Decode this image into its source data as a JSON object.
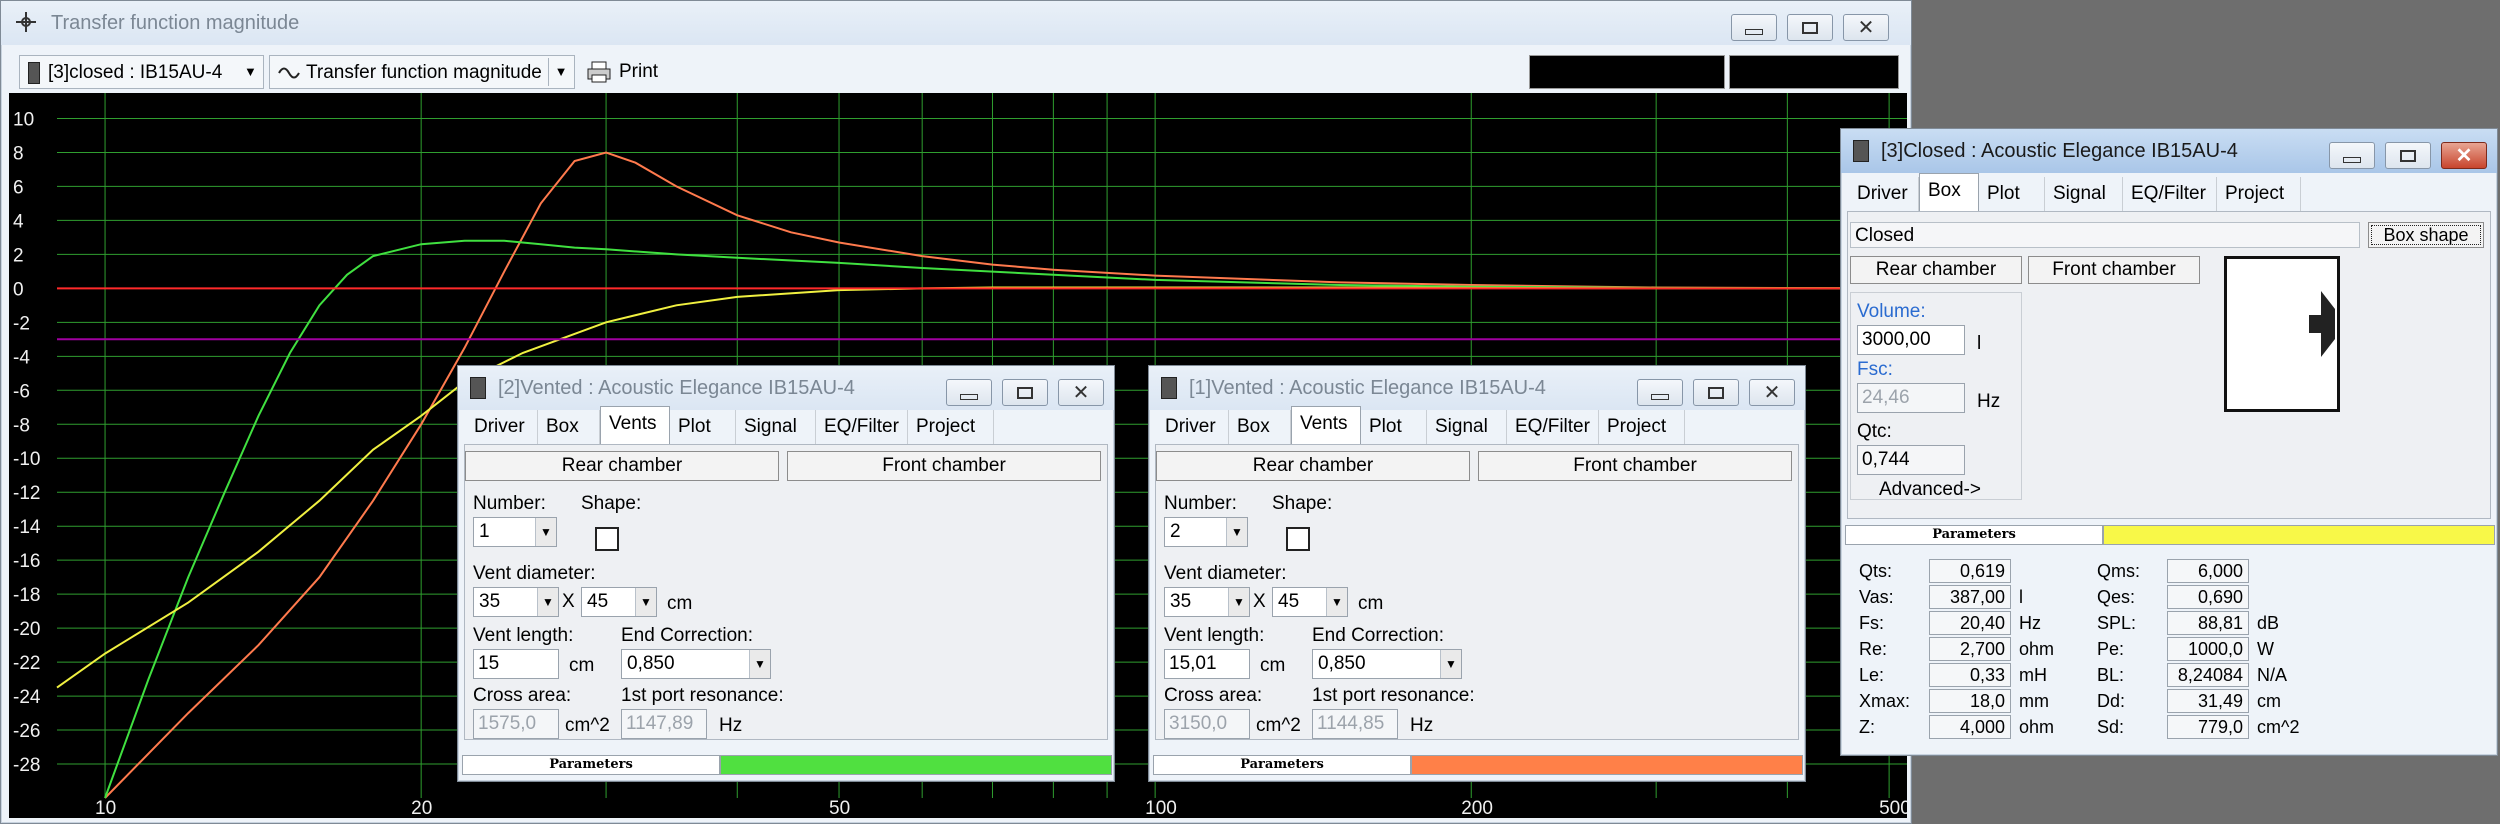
{
  "main_window": {
    "title": "Transfer function magnitude",
    "selector": "[3]closed : IB15AU-4",
    "view": "Transfer function magnitude",
    "print_label": "Print"
  },
  "chart_data": {
    "type": "line",
    "xscale": "log",
    "xlim": [
      9,
      520
    ],
    "ylim": [
      -30,
      11.5
    ],
    "xticks": [
      "10",
      "20",
      "50",
      "100",
      "200",
      "500"
    ],
    "xtick_values": [
      10,
      20,
      50,
      100,
      200,
      500
    ],
    "yticks": [
      "10",
      "8",
      "6",
      "4",
      "2",
      "0",
      "-2",
      "-4",
      "-6",
      "-8",
      "-10",
      "-12",
      "-14",
      "-16",
      "-18",
      "-20",
      "-22",
      "-24",
      "-26",
      "-28"
    ],
    "ytick_values": [
      10,
      8,
      6,
      4,
      2,
      0,
      -2,
      -4,
      -6,
      -8,
      -10,
      -12,
      -14,
      -16,
      -18,
      -20,
      -22,
      -24,
      -26,
      -28
    ],
    "vertical_grid": [
      10,
      20,
      30,
      40,
      50,
      60,
      70,
      80,
      90,
      100,
      200,
      300,
      400,
      500
    ],
    "colors": {
      "grid": "#2f9e2f",
      "background": "#000000",
      "zero": "#ff2a2a",
      "purple": "#a000a0"
    },
    "series": [
      {
        "color": "#ff7a4d",
        "x": [
          10,
          12,
          14,
          16,
          18,
          20,
          22,
          24,
          26,
          28,
          30,
          32,
          35,
          40,
          45,
          50,
          60,
          70,
          80,
          100,
          150,
          200,
          300,
          500
        ],
        "y": [
          -30,
          -25,
          -21,
          -17,
          -12.5,
          -8,
          -3.5,
          1,
          5,
          7.5,
          8,
          7.4,
          6,
          4.3,
          3.3,
          2.7,
          1.9,
          1.4,
          1.1,
          0.75,
          0.35,
          0.2,
          0.05,
          0
        ]
      },
      {
        "color": "#40e040",
        "x": [
          10,
          11,
          12,
          13,
          14,
          15,
          16,
          17,
          18,
          20,
          22,
          24,
          26,
          28,
          30,
          35,
          40,
          50,
          60,
          80,
          100,
          150,
          200,
          300,
          500
        ],
        "y": [
          -30,
          -23,
          -17,
          -12,
          -7.5,
          -3.8,
          -1,
          0.8,
          1.9,
          2.6,
          2.8,
          2.8,
          2.6,
          2.4,
          2.3,
          2,
          1.8,
          1.5,
          1.2,
          0.8,
          0.5,
          0.2,
          0.1,
          0.03,
          0
        ]
      },
      {
        "color": "#f0f040",
        "x": [
          9,
          10,
          12,
          14,
          16,
          18,
          20,
          22,
          25,
          30,
          35,
          40,
          50,
          60,
          70,
          80,
          100,
          150,
          200,
          300,
          500
        ],
        "y": [
          -23.5,
          -21.5,
          -18.5,
          -15.5,
          -12.5,
          -9.5,
          -7.5,
          -5.5,
          -3.8,
          -2,
          -1,
          -0.5,
          -0.1,
          0,
          0.05,
          0.05,
          0.05,
          0.05,
          0.03,
          0.01,
          0
        ]
      },
      {
        "color": "#ff2a2a",
        "x": [
          9,
          520
        ],
        "y": [
          0,
          0
        ]
      },
      {
        "color": "#a000a0",
        "x": [
          9,
          520
        ],
        "y": [
          -3,
          -3
        ]
      }
    ]
  },
  "win_closed": {
    "title": "[3]Closed : Acoustic Elegance IB15AU-4",
    "tabs": [
      "Driver",
      "Box",
      "Plot",
      "Signal",
      "EQ/Filter",
      "Project"
    ],
    "selected_tab": "Box",
    "box_type": "Closed",
    "box_shape_btn": "Box shape",
    "rear_chamber": "Rear chamber",
    "front_chamber": "Front chamber",
    "volume_label": "Volume:",
    "volume_value": "3000,00",
    "volume_unit": "l",
    "fsc_label": "Fsc:",
    "fsc_value": "24,46",
    "fsc_unit": "Hz",
    "qtc_label": "Qtc:",
    "qtc_value": "0,744",
    "advanced": "Advanced->",
    "params_label": "Parameters",
    "param_color": "#f8f848",
    "params_left": [
      {
        "name": "Qts:",
        "value": "0,619",
        "unit": ""
      },
      {
        "name": "Vas:",
        "value": "387,00",
        "unit": "l"
      },
      {
        "name": "Fs:",
        "value": "20,40",
        "unit": "Hz"
      },
      {
        "name": "Re:",
        "value": "2,700",
        "unit": "ohm"
      },
      {
        "name": "Le:",
        "value": "0,33",
        "unit": "mH"
      },
      {
        "name": "Xmax:",
        "value": "18,0",
        "unit": "mm"
      },
      {
        "name": "Z:",
        "value": "4,000",
        "unit": "ohm"
      }
    ],
    "params_right": [
      {
        "name": "Qms:",
        "value": "6,000",
        "unit": ""
      },
      {
        "name": "Qes:",
        "value": "0,690",
        "unit": ""
      },
      {
        "name": "SPL:",
        "value": "88,81",
        "unit": "dB"
      },
      {
        "name": "Pe:",
        "value": "1000,0",
        "unit": "W"
      },
      {
        "name": "BL:",
        "value": "8,24084",
        "unit": "N/A"
      },
      {
        "name": "Dd:",
        "value": "31,49",
        "unit": "cm"
      },
      {
        "name": "Sd:",
        "value": "779,0",
        "unit": "cm^2"
      }
    ]
  },
  "win_vented2": {
    "title": "[2]Vented : Acoustic Elegance IB15AU-4",
    "tabs": [
      "Driver",
      "Box",
      "Vents",
      "Plot",
      "Signal",
      "EQ/Filter",
      "Project"
    ],
    "selected_tab": "Vents",
    "rear_chamber": "Rear chamber",
    "front_chamber": "Front chamber",
    "number_label": "Number:",
    "number_value": "1",
    "shape_label": "Shape:",
    "diam_label": "Vent diameter:",
    "diam1": "35",
    "diam2": "45",
    "diam_unit": "cm",
    "length_label": "Vent length:",
    "length_value": "15",
    "length_unit": "cm",
    "endcorr_label": "End Correction:",
    "endcorr_value": "0,850",
    "cross_label": "Cross area:",
    "cross_value": "1575,0",
    "cross_unit": "cm^2",
    "port_label": "1st port resonance:",
    "port_value": "1147,89",
    "port_unit": "Hz",
    "params_label": "Parameters",
    "param_color": "#50e040"
  },
  "win_vented1": {
    "title": "[1]Vented : Acoustic Elegance IB15AU-4",
    "tabs": [
      "Driver",
      "Box",
      "Vents",
      "Plot",
      "Signal",
      "EQ/Filter",
      "Project"
    ],
    "selected_tab": "Vents",
    "rear_chamber": "Rear chamber",
    "front_chamber": "Front chamber",
    "number_label": "Number:",
    "number_value": "2",
    "shape_label": "Shape:",
    "diam_label": "Vent diameter:",
    "diam1": "35",
    "diam2": "45",
    "diam_unit": "cm",
    "length_label": "Vent length:",
    "length_value": "15,01",
    "length_unit": "cm",
    "endcorr_label": "End Correction:",
    "endcorr_value": "0,850",
    "cross_label": "Cross area:",
    "cross_value": "3150,0",
    "cross_unit": "cm^2",
    "port_label": "1st port resonance:",
    "port_value": "1144,85",
    "port_unit": "Hz",
    "params_label": "Parameters",
    "param_color": "#ff8048"
  }
}
